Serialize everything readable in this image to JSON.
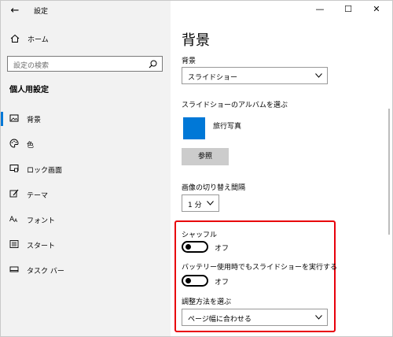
{
  "window": {
    "app_title": "設定",
    "back_glyph": "←",
    "controls": {
      "minimize": "—",
      "maximize": "☐",
      "close": "✕"
    }
  },
  "sidebar": {
    "home_label": "ホーム",
    "search_placeholder": "設定の検索",
    "section_title": "個人用設定",
    "items": [
      {
        "label": "背景",
        "icon": "image-icon",
        "selected": true
      },
      {
        "label": "色",
        "icon": "palette-icon",
        "selected": false
      },
      {
        "label": "ロック画面",
        "icon": "lock-screen-icon",
        "selected": false
      },
      {
        "label": "テーマ",
        "icon": "theme-brush-icon",
        "selected": false
      },
      {
        "label": "フォント",
        "icon": "font-icon",
        "selected": false
      },
      {
        "label": "スタート",
        "icon": "start-icon",
        "selected": false
      },
      {
        "label": "タスク バー",
        "icon": "taskbar-icon",
        "selected": false
      }
    ]
  },
  "main": {
    "page_title": "背景",
    "background_label": "背景",
    "background_value": "スライドショー",
    "album_label": "スライドショーのアルバムを選ぶ",
    "album_name": "旅行写真",
    "browse_label": "参照",
    "interval_label": "画像の切り替え間隔",
    "interval_value": "1 分",
    "shuffle_label": "シャッフル",
    "shuffle_state": "オフ",
    "battery_label": "バッテリー使用時でもスライドショーを実行する",
    "battery_state": "オフ",
    "fit_label": "調整方法を選ぶ",
    "fit_value": "ページ幅に合わせる"
  },
  "colors": {
    "accent": "#0078d7",
    "highlight": "#e8000b",
    "sidebar_bg": "#f2f2f2"
  }
}
